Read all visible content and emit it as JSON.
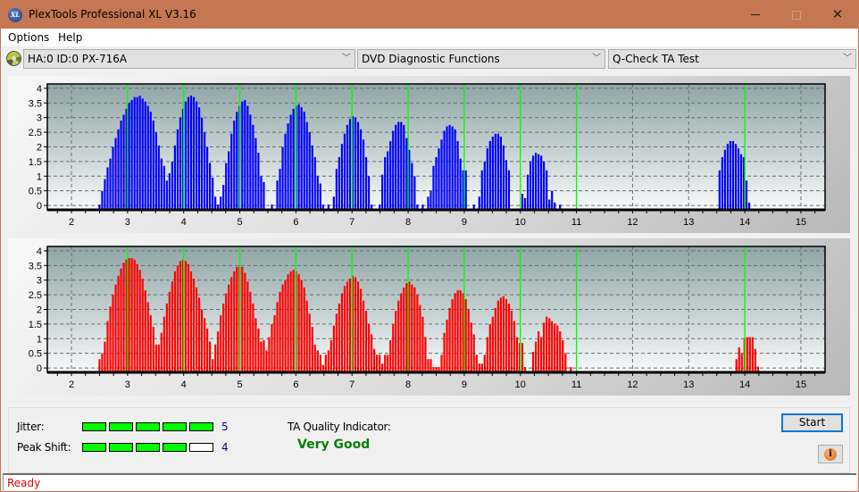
{
  "window": {
    "title": "PlexTools Professional XL V3.16",
    "app_icon_text": "XL",
    "controls": {
      "minimize": "minimize-icon",
      "maximize": "maximize-icon",
      "close": "close-icon"
    }
  },
  "menu": [
    {
      "label": "Options"
    },
    {
      "label": "Help"
    }
  ],
  "toolbar": {
    "drive_icon": "disc-drive-icon",
    "drive": "HA:0 ID:0  PX-716A",
    "function": "DVD Diagnostic Functions",
    "test": "Q-Check TA Test"
  },
  "colors": {
    "titlebar": "#c47752",
    "land_bars": "#0000ff",
    "pit_bars": "#ff0000",
    "reference_lines": "#00ff00",
    "meter_on": "#00ff00",
    "quality_text": "#0a7c0a",
    "status_text": "#e00000"
  },
  "chart_data": [
    {
      "type": "bar",
      "name": "TA histogram (top, blue)",
      "title": "",
      "xlabel": "",
      "ylabel": "",
      "xlim": [
        1.57,
        15.43
      ],
      "ylim": [
        -0.15,
        4.15
      ],
      "x_ticks": [
        2,
        3,
        4,
        5,
        6,
        7,
        8,
        9,
        10,
        11,
        12,
        13,
        14,
        15
      ],
      "y_ticks": [
        0,
        0.5,
        1,
        1.5,
        2,
        2.5,
        3,
        3.5,
        4
      ],
      "y_tick_labels": [
        "0",
        "0.5",
        "1",
        "1.5",
        "2",
        "2.5",
        "3",
        "3.5",
        "4"
      ],
      "grid": true,
      "reference_lines_x": [
        3,
        4,
        5,
        6,
        7,
        8,
        9,
        10,
        11,
        14
      ],
      "bar_color": "#0000ff",
      "x_start": 2.5,
      "x_step": 0.048,
      "values": [
        0.0,
        0.5,
        0.9,
        1.3,
        1.6,
        2.0,
        2.3,
        2.6,
        2.9,
        3.1,
        3.3,
        3.5,
        3.6,
        3.7,
        3.7,
        3.75,
        3.65,
        3.55,
        3.4,
        3.2,
        2.9,
        2.5,
        2.05,
        1.6,
        1.35,
        0.85,
        1.1,
        1.5,
        2.05,
        2.6,
        3.0,
        3.3,
        3.55,
        3.7,
        3.75,
        3.7,
        3.55,
        3.35,
        3.0,
        2.5,
        2.0,
        1.45,
        0.95,
        0.3,
        0.0,
        0.3,
        0.7,
        1.45,
        1.85,
        2.45,
        2.9,
        3.2,
        3.4,
        3.55,
        3.6,
        3.4,
        3.1,
        2.75,
        2.3,
        1.8,
        1.0,
        0.8,
        -1,
        -1,
        0.0,
        -1,
        0.85,
        1.25,
        2.0,
        2.45,
        2.8,
        3.1,
        3.3,
        3.4,
        3.45,
        3.35,
        3.2,
        2.85,
        2.5,
        2.05,
        1.65,
        1.0,
        0.75,
        0.0,
        -1,
        0.0,
        -1,
        0.3,
        1.25,
        1.65,
        2.1,
        2.45,
        2.75,
        2.95,
        3.05,
        3.0,
        2.85,
        2.6,
        2.25,
        1.65,
        1.0,
        0.0,
        -1,
        -1,
        0.0,
        1.05,
        1.65,
        1.85,
        2.2,
        2.55,
        2.75,
        2.85,
        2.85,
        2.75,
        2.3,
        1.9,
        1.45,
        1.0,
        0.0,
        -1,
        0.0,
        -1,
        0.3,
        0.5,
        1.35,
        1.65,
        1.95,
        2.25,
        2.55,
        2.7,
        2.75,
        2.7,
        2.6,
        2.2,
        1.6,
        1.2,
        1.2,
        -1,
        -1,
        0.0,
        -1,
        0.3,
        1.2,
        1.5,
        1.95,
        2.2,
        2.35,
        2.45,
        2.45,
        2.35,
        2.05,
        1.55,
        1.2,
        -1,
        -1,
        -1,
        -1,
        0.4,
        0.25,
        1.05,
        1.5,
        1.7,
        1.8,
        1.75,
        1.7,
        1.5,
        1.2,
        0.2,
        0.5,
        0.1,
        -1,
        0.0
      ],
      "values_note": "-1 = no bar",
      "cluster_14": {
        "x_start": 13.55,
        "values": [
          1.2,
          1.65,
          1.9,
          2.1,
          2.2,
          2.2,
          2.1,
          1.95,
          1.75,
          1.65,
          0.85,
          0.1
        ]
      }
    },
    {
      "type": "bar",
      "name": "TA histogram (bottom, red)",
      "title": "",
      "xlabel": "",
      "ylabel": "",
      "xlim": [
        1.57,
        15.43
      ],
      "ylim": [
        -0.15,
        4.15
      ],
      "x_ticks": [
        2,
        3,
        4,
        5,
        6,
        7,
        8,
        9,
        10,
        11,
        12,
        13,
        14,
        15
      ],
      "y_ticks": [
        0,
        0.5,
        1,
        1.5,
        2,
        2.5,
        3,
        3.5,
        4
      ],
      "y_tick_labels": [
        "0",
        "0.5",
        "1",
        "1.5",
        "2",
        "2.5",
        "3",
        "3.5",
        "4"
      ],
      "grid": true,
      "reference_lines_x": [
        3,
        4,
        5,
        6,
        7,
        8,
        9,
        10,
        11,
        14
      ],
      "bar_color": "#ff0000",
      "x_start": 2.5,
      "x_step": 0.048,
      "values": [
        0.3,
        0.5,
        0.9,
        1.6,
        2.1,
        2.5,
        2.85,
        3.15,
        3.4,
        3.6,
        3.7,
        3.75,
        3.75,
        3.7,
        3.55,
        3.35,
        3.05,
        2.65,
        2.25,
        1.8,
        1.4,
        0.8,
        0.8,
        1.2,
        1.75,
        2.2,
        2.6,
        2.95,
        3.3,
        3.5,
        3.65,
        3.7,
        3.65,
        3.55,
        3.3,
        3.05,
        2.75,
        2.4,
        2.0,
        1.7,
        1.35,
        0.9,
        0.3,
        0.8,
        1.25,
        1.8,
        2.2,
        2.55,
        2.85,
        3.1,
        3.3,
        3.45,
        3.5,
        3.45,
        3.25,
        2.95,
        2.6,
        2.2,
        1.7,
        1.35,
        0.9,
        0.95,
        0.6,
        1.05,
        1.5,
        1.8,
        2.25,
        2.6,
        2.85,
        3.0,
        3.2,
        3.3,
        3.35,
        3.3,
        3.2,
        3.0,
        2.75,
        2.3,
        1.85,
        1.4,
        0.8,
        0.6,
        0.45,
        0.1,
        0.45,
        0.6,
        0.95,
        1.45,
        1.85,
        2.2,
        2.55,
        2.8,
        2.95,
        3.05,
        3.15,
        3.1,
        2.95,
        2.7,
        2.3,
        1.95,
        1.5,
        1.15,
        0.65,
        0.45,
        0.45,
        0.15,
        0.45,
        0.45,
        0.95,
        1.5,
        1.95,
        2.3,
        2.55,
        2.75,
        2.9,
        2.95,
        2.85,
        2.75,
        2.5,
        2.15,
        1.75,
        1.05,
        0.3,
        0.3,
        0.0,
        0.0,
        0.0,
        0.45,
        1.2,
        1.65,
        2.05,
        2.35,
        2.55,
        2.65,
        2.65,
        2.55,
        2.35,
        2.0,
        1.55,
        1.15,
        0.45,
        0.15,
        0.15,
        0.45,
        1.05,
        1.5,
        1.75,
        2.05,
        2.3,
        2.4,
        2.45,
        2.35,
        2.2,
        1.95,
        1.6,
        1.05,
        0.85,
        0.85,
        0.0,
        -1,
        -1,
        0.55,
        0.9,
        1.25,
        1.05,
        1.55,
        1.75,
        1.7,
        1.6,
        1.5,
        1.45,
        1.25,
        0.95,
        0.5,
        -1,
        0.0
      ],
      "values_note": "-1 = no bar",
      "cluster_14": {
        "x_start": 13.85,
        "values": [
          0.3,
          0.7,
          0.5,
          1.0,
          1.05,
          1.05,
          1.05,
          0.65,
          0.05
        ]
      }
    }
  ],
  "results": {
    "jitter": {
      "label": "Jitter:",
      "value": "5",
      "level": 5,
      "max": 5
    },
    "peak_shift": {
      "label": "Peak Shift:",
      "value": "4",
      "level": 4,
      "max": 5
    },
    "ta_quality_label": "TA Quality Indicator:",
    "ta_quality_value": "Very Good"
  },
  "buttons": {
    "start": "Start",
    "info_icon": "info-icon"
  },
  "status": {
    "text": "Ready"
  }
}
